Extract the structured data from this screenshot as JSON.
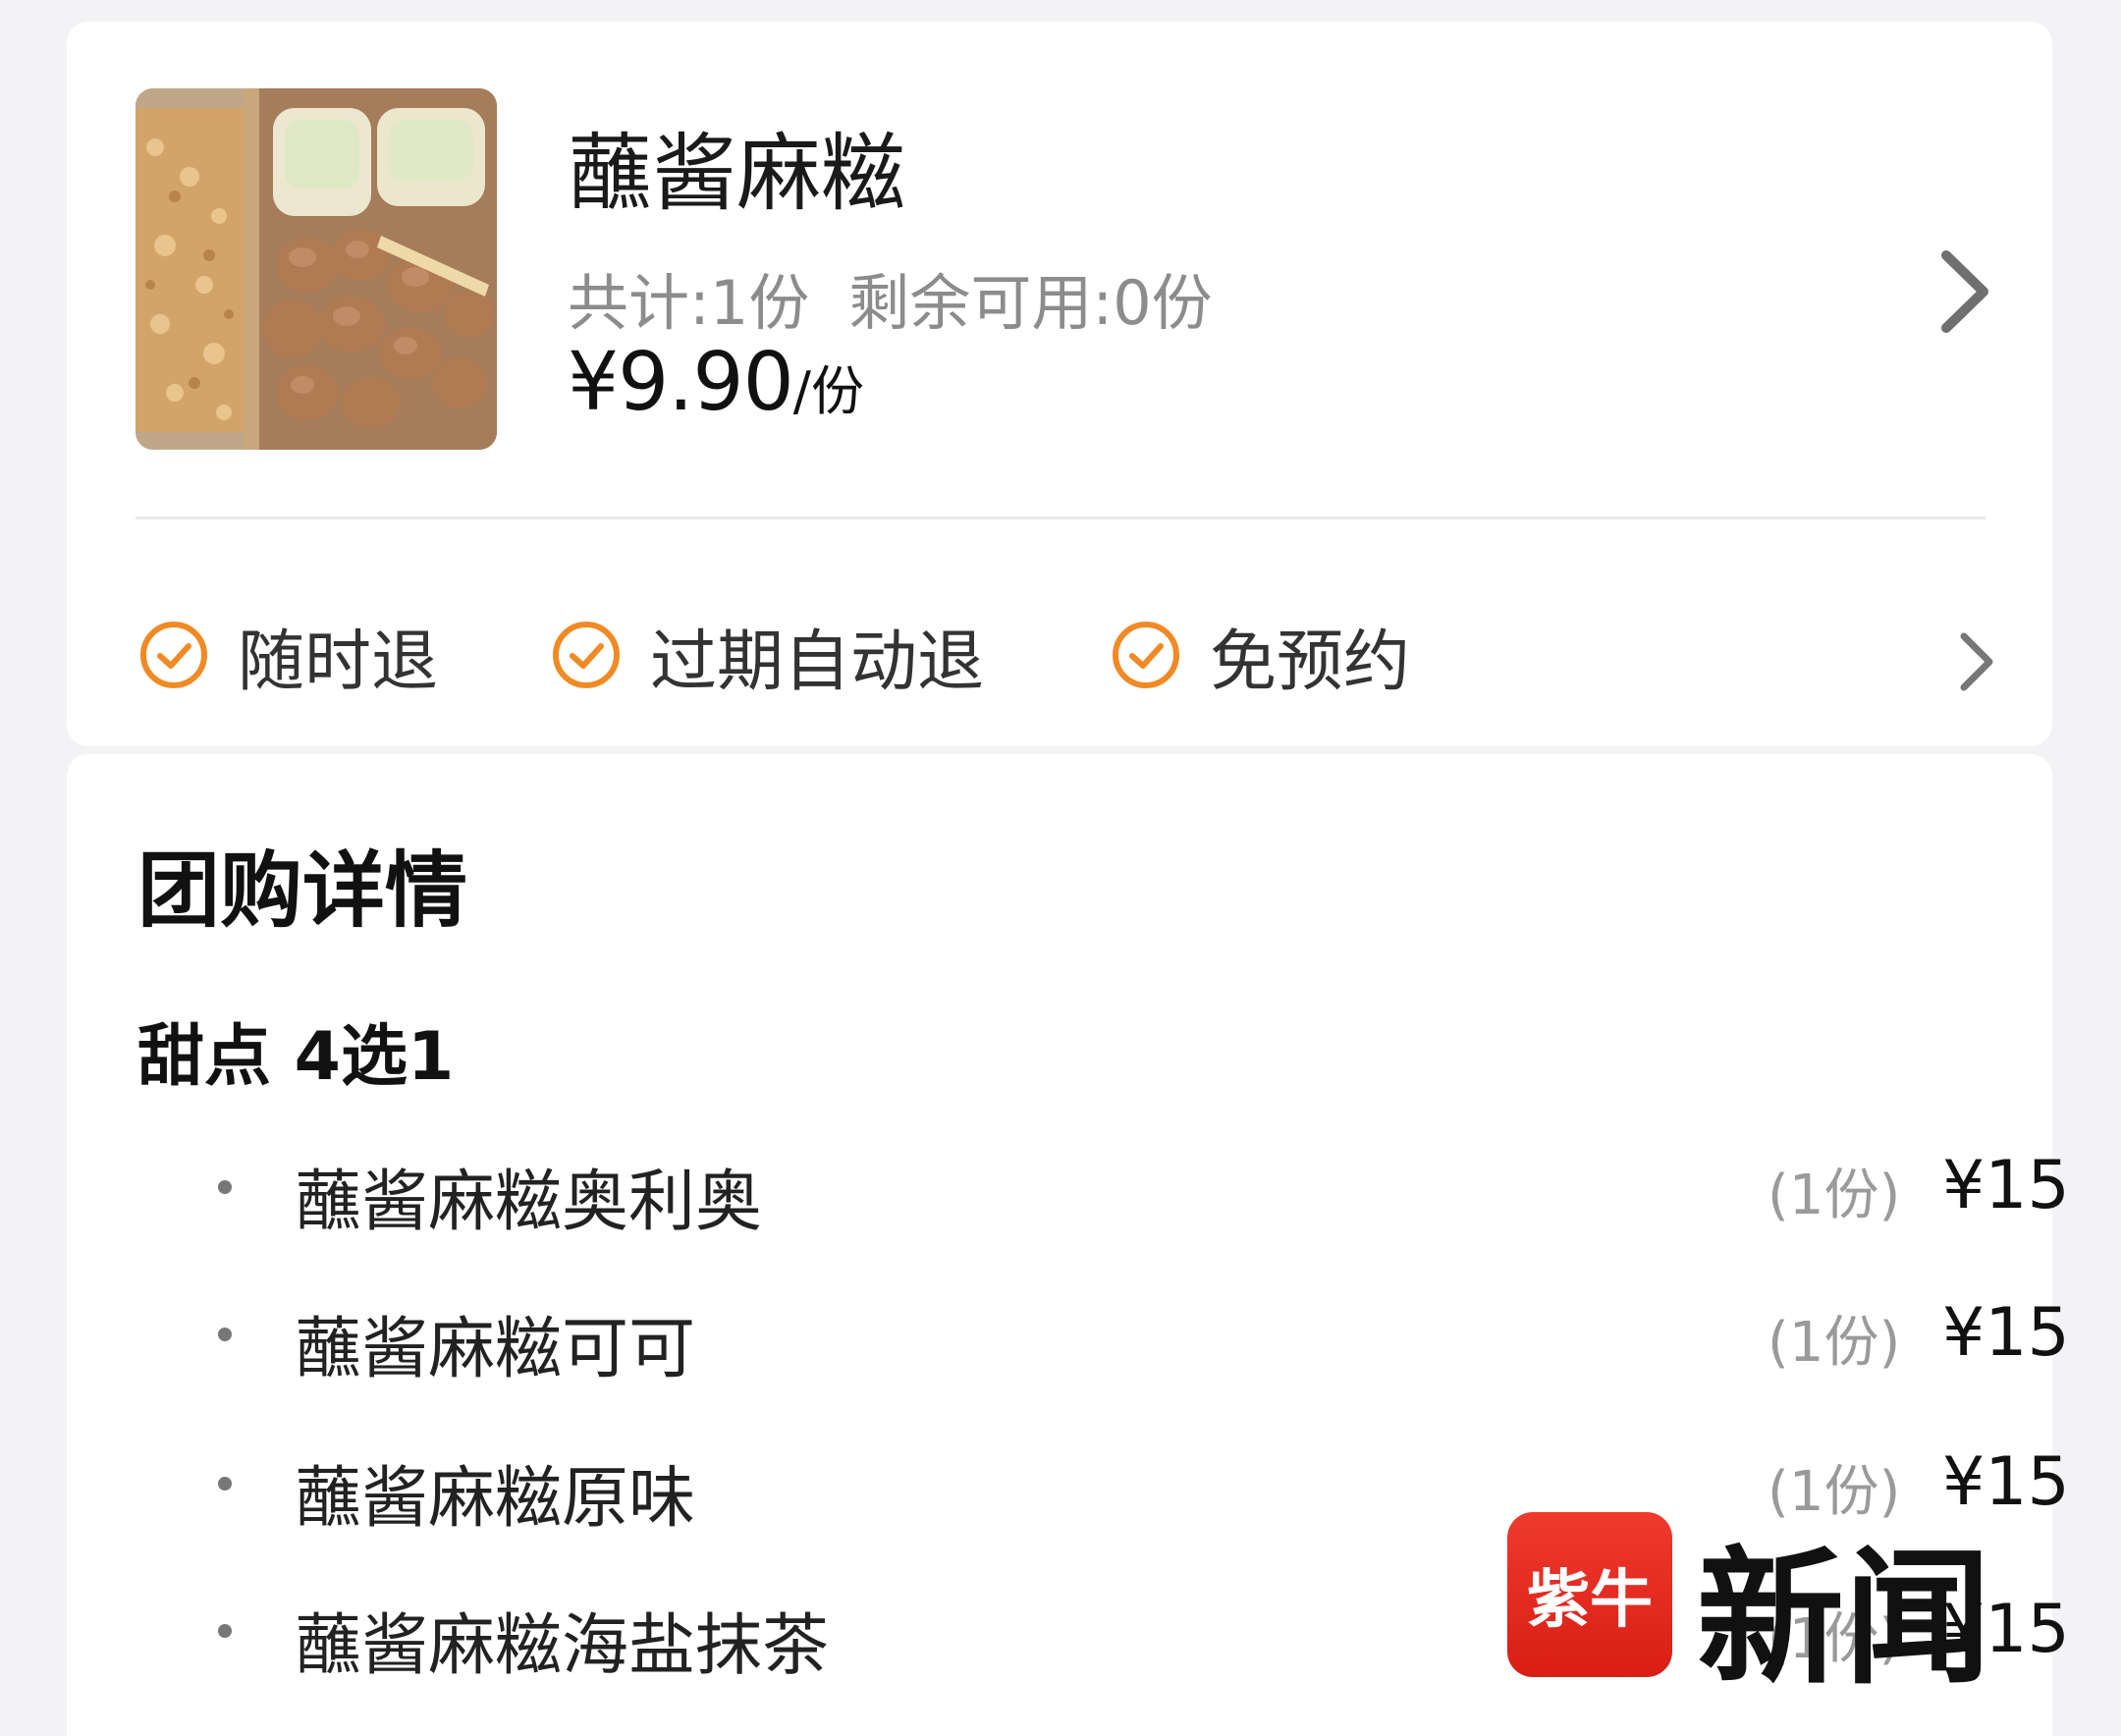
{
  "product": {
    "title": "蘸酱麻糍",
    "total": "共计:1份",
    "remaining": "剩余可用:0份",
    "price": "¥9.90",
    "price_unit": "/份"
  },
  "features": [
    {
      "label": "随时退",
      "icon": "check-circle-icon"
    },
    {
      "label": "过期自动退",
      "icon": "check-circle-icon"
    },
    {
      "label": "免预约",
      "icon": "check-circle-icon"
    }
  ],
  "detail": {
    "section_title": "团购详情",
    "group_title": "甜点 4选1",
    "items": [
      {
        "name": "蘸酱麻糍奥利奥",
        "qty": "(1份)",
        "price": "¥15"
      },
      {
        "name": "蘸酱麻糍可可",
        "qty": "(1份)",
        "price": "¥15"
      },
      {
        "name": "蘸酱麻糍原味",
        "qty": "(1份)",
        "price": "¥15"
      },
      {
        "name": "蘸酱麻糍海盐抹茶",
        "qty": "(1份)",
        "price": "¥15"
      }
    ]
  },
  "watermark": {
    "logo_text": "紫牛",
    "text": "新闻"
  },
  "colors": {
    "accent_orange": "#f08a24",
    "logo_red": "#e02a20"
  }
}
